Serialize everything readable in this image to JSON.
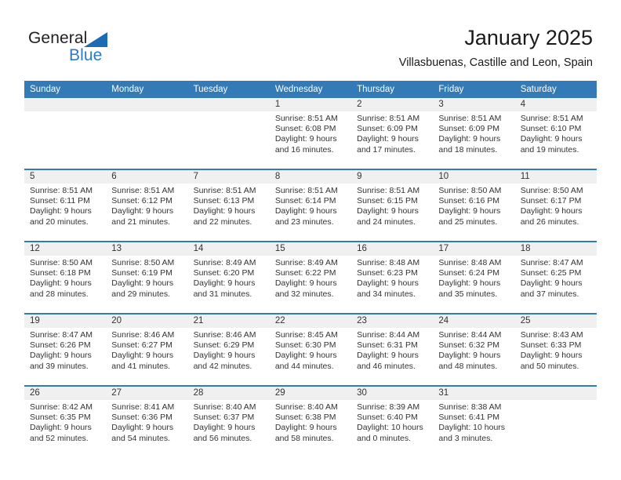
{
  "brand": {
    "name_part1": "General",
    "name_part2": "Blue"
  },
  "header": {
    "title": "January 2025",
    "subtitle": "Villasbuenas, Castille and Leon, Spain"
  },
  "colors": {
    "header_blue": "#337ab7",
    "logo_blue": "#2b7cc4",
    "daynum_band": "#f0f0f0"
  },
  "weekdays": [
    "Sunday",
    "Monday",
    "Tuesday",
    "Wednesday",
    "Thursday",
    "Friday",
    "Saturday"
  ],
  "weeks": [
    [
      {
        "day": "",
        "lines": []
      },
      {
        "day": "",
        "lines": []
      },
      {
        "day": "",
        "lines": []
      },
      {
        "day": "1",
        "lines": [
          "Sunrise: 8:51 AM",
          "Sunset: 6:08 PM",
          "Daylight: 9 hours",
          "and 16 minutes."
        ]
      },
      {
        "day": "2",
        "lines": [
          "Sunrise: 8:51 AM",
          "Sunset: 6:09 PM",
          "Daylight: 9 hours",
          "and 17 minutes."
        ]
      },
      {
        "day": "3",
        "lines": [
          "Sunrise: 8:51 AM",
          "Sunset: 6:09 PM",
          "Daylight: 9 hours",
          "and 18 minutes."
        ]
      },
      {
        "day": "4",
        "lines": [
          "Sunrise: 8:51 AM",
          "Sunset: 6:10 PM",
          "Daylight: 9 hours",
          "and 19 minutes."
        ]
      }
    ],
    [
      {
        "day": "5",
        "lines": [
          "Sunrise: 8:51 AM",
          "Sunset: 6:11 PM",
          "Daylight: 9 hours",
          "and 20 minutes."
        ]
      },
      {
        "day": "6",
        "lines": [
          "Sunrise: 8:51 AM",
          "Sunset: 6:12 PM",
          "Daylight: 9 hours",
          "and 21 minutes."
        ]
      },
      {
        "day": "7",
        "lines": [
          "Sunrise: 8:51 AM",
          "Sunset: 6:13 PM",
          "Daylight: 9 hours",
          "and 22 minutes."
        ]
      },
      {
        "day": "8",
        "lines": [
          "Sunrise: 8:51 AM",
          "Sunset: 6:14 PM",
          "Daylight: 9 hours",
          "and 23 minutes."
        ]
      },
      {
        "day": "9",
        "lines": [
          "Sunrise: 8:51 AM",
          "Sunset: 6:15 PM",
          "Daylight: 9 hours",
          "and 24 minutes."
        ]
      },
      {
        "day": "10",
        "lines": [
          "Sunrise: 8:50 AM",
          "Sunset: 6:16 PM",
          "Daylight: 9 hours",
          "and 25 minutes."
        ]
      },
      {
        "day": "11",
        "lines": [
          "Sunrise: 8:50 AM",
          "Sunset: 6:17 PM",
          "Daylight: 9 hours",
          "and 26 minutes."
        ]
      }
    ],
    [
      {
        "day": "12",
        "lines": [
          "Sunrise: 8:50 AM",
          "Sunset: 6:18 PM",
          "Daylight: 9 hours",
          "and 28 minutes."
        ]
      },
      {
        "day": "13",
        "lines": [
          "Sunrise: 8:50 AM",
          "Sunset: 6:19 PM",
          "Daylight: 9 hours",
          "and 29 minutes."
        ]
      },
      {
        "day": "14",
        "lines": [
          "Sunrise: 8:49 AM",
          "Sunset: 6:20 PM",
          "Daylight: 9 hours",
          "and 31 minutes."
        ]
      },
      {
        "day": "15",
        "lines": [
          "Sunrise: 8:49 AM",
          "Sunset: 6:22 PM",
          "Daylight: 9 hours",
          "and 32 minutes."
        ]
      },
      {
        "day": "16",
        "lines": [
          "Sunrise: 8:48 AM",
          "Sunset: 6:23 PM",
          "Daylight: 9 hours",
          "and 34 minutes."
        ]
      },
      {
        "day": "17",
        "lines": [
          "Sunrise: 8:48 AM",
          "Sunset: 6:24 PM",
          "Daylight: 9 hours",
          "and 35 minutes."
        ]
      },
      {
        "day": "18",
        "lines": [
          "Sunrise: 8:47 AM",
          "Sunset: 6:25 PM",
          "Daylight: 9 hours",
          "and 37 minutes."
        ]
      }
    ],
    [
      {
        "day": "19",
        "lines": [
          "Sunrise: 8:47 AM",
          "Sunset: 6:26 PM",
          "Daylight: 9 hours",
          "and 39 minutes."
        ]
      },
      {
        "day": "20",
        "lines": [
          "Sunrise: 8:46 AM",
          "Sunset: 6:27 PM",
          "Daylight: 9 hours",
          "and 41 minutes."
        ]
      },
      {
        "day": "21",
        "lines": [
          "Sunrise: 8:46 AM",
          "Sunset: 6:29 PM",
          "Daylight: 9 hours",
          "and 42 minutes."
        ]
      },
      {
        "day": "22",
        "lines": [
          "Sunrise: 8:45 AM",
          "Sunset: 6:30 PM",
          "Daylight: 9 hours",
          "and 44 minutes."
        ]
      },
      {
        "day": "23",
        "lines": [
          "Sunrise: 8:44 AM",
          "Sunset: 6:31 PM",
          "Daylight: 9 hours",
          "and 46 minutes."
        ]
      },
      {
        "day": "24",
        "lines": [
          "Sunrise: 8:44 AM",
          "Sunset: 6:32 PM",
          "Daylight: 9 hours",
          "and 48 minutes."
        ]
      },
      {
        "day": "25",
        "lines": [
          "Sunrise: 8:43 AM",
          "Sunset: 6:33 PM",
          "Daylight: 9 hours",
          "and 50 minutes."
        ]
      }
    ],
    [
      {
        "day": "26",
        "lines": [
          "Sunrise: 8:42 AM",
          "Sunset: 6:35 PM",
          "Daylight: 9 hours",
          "and 52 minutes."
        ]
      },
      {
        "day": "27",
        "lines": [
          "Sunrise: 8:41 AM",
          "Sunset: 6:36 PM",
          "Daylight: 9 hours",
          "and 54 minutes."
        ]
      },
      {
        "day": "28",
        "lines": [
          "Sunrise: 8:40 AM",
          "Sunset: 6:37 PM",
          "Daylight: 9 hours",
          "and 56 minutes."
        ]
      },
      {
        "day": "29",
        "lines": [
          "Sunrise: 8:40 AM",
          "Sunset: 6:38 PM",
          "Daylight: 9 hours",
          "and 58 minutes."
        ]
      },
      {
        "day": "30",
        "lines": [
          "Sunrise: 8:39 AM",
          "Sunset: 6:40 PM",
          "Daylight: 10 hours",
          "and 0 minutes."
        ]
      },
      {
        "day": "31",
        "lines": [
          "Sunrise: 8:38 AM",
          "Sunset: 6:41 PM",
          "Daylight: 10 hours",
          "and 3 minutes."
        ]
      },
      {
        "day": "",
        "lines": []
      }
    ]
  ]
}
